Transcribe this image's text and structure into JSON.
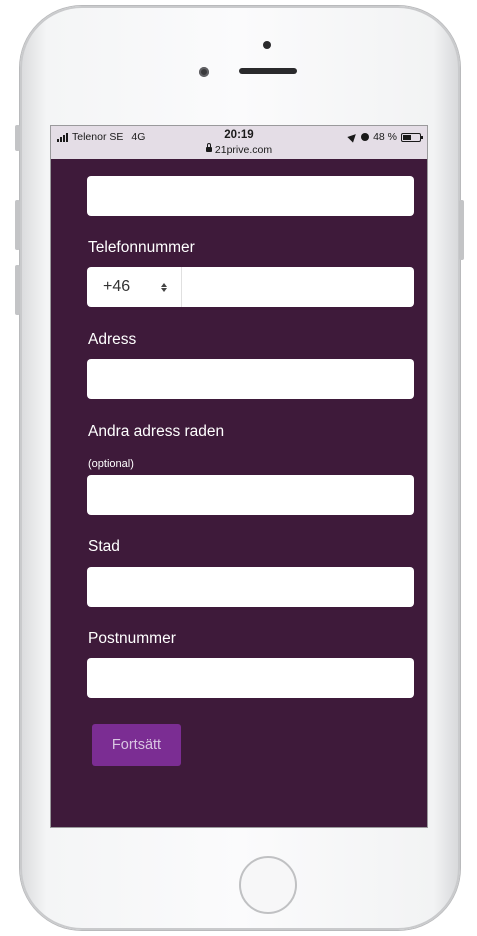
{
  "status_bar": {
    "carrier": "Telenor SE",
    "network": "4G",
    "time": "20:19",
    "url": "21prive.com",
    "battery": "48 %",
    "battery_level": 0.48
  },
  "form": {
    "phone": {
      "label": "Telefonnummer",
      "country_code": "+46",
      "value": ""
    },
    "address": {
      "label": "Adress",
      "value": ""
    },
    "address2": {
      "label": "Andra adress raden",
      "note": "(optional)",
      "value": ""
    },
    "city": {
      "label": "Stad",
      "value": ""
    },
    "postcode": {
      "label": "Postnummer",
      "value": ""
    },
    "submit_label": "Fortsätt"
  },
  "colors": {
    "page_background": "#3e1a3a",
    "button": "#7b2d93",
    "status_bar": "#e4dde6"
  }
}
